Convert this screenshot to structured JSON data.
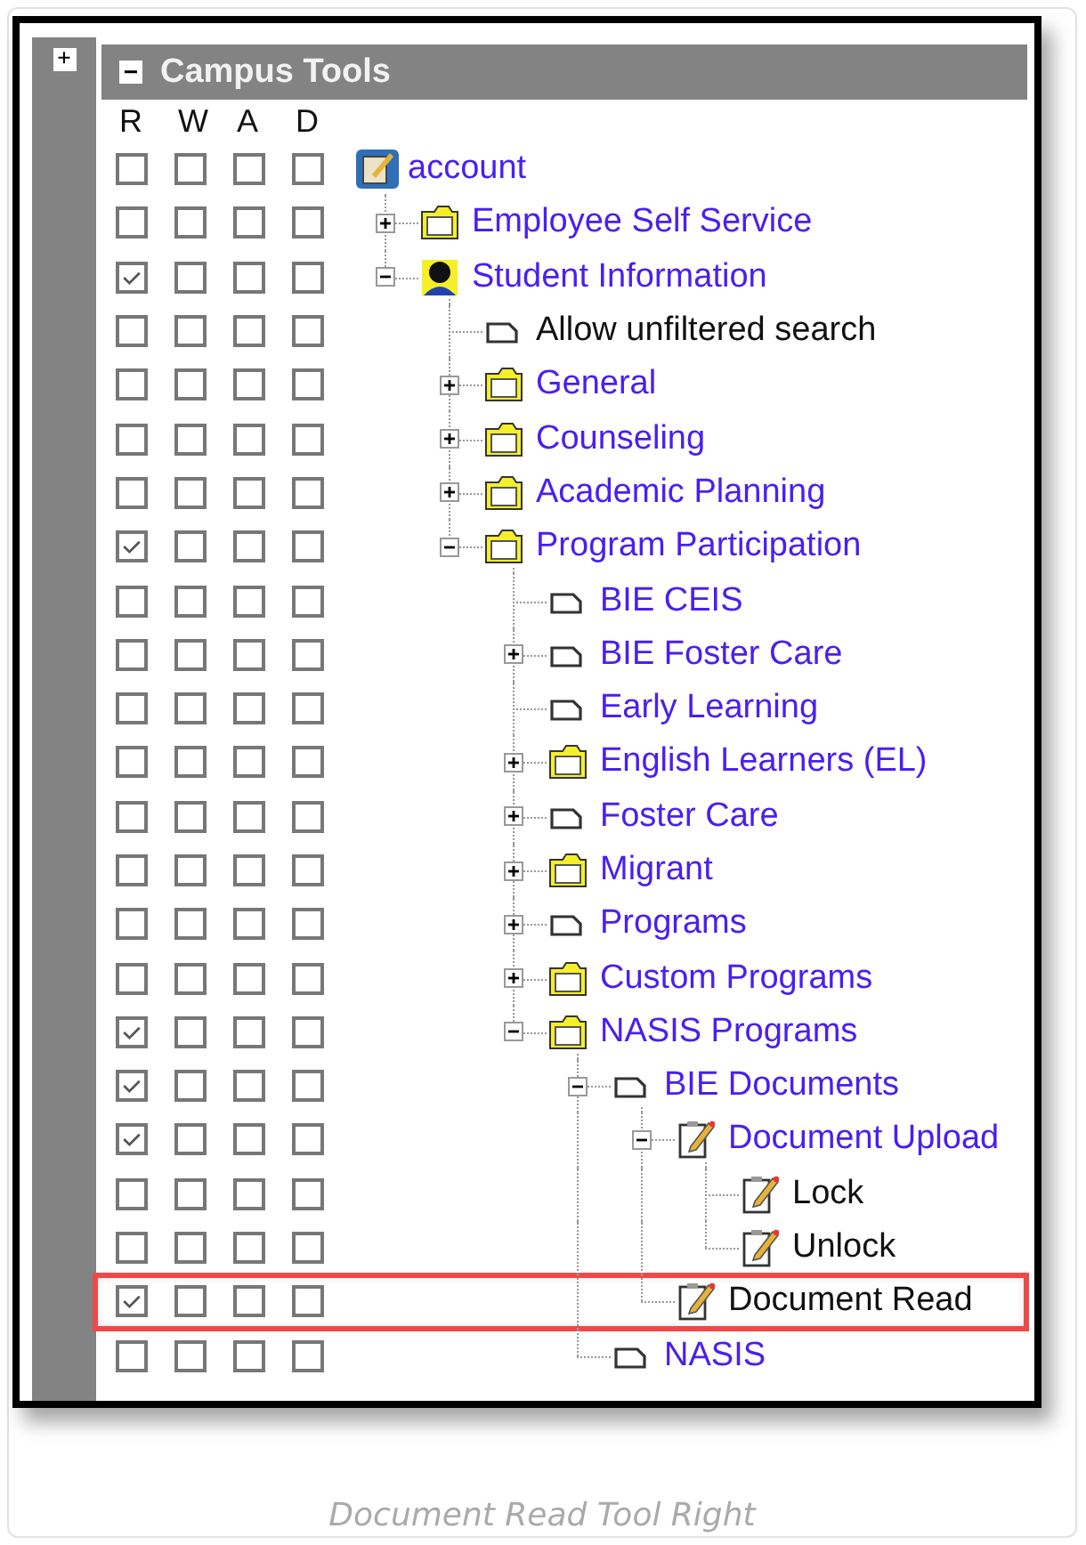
{
  "header": {
    "expand_icon": "+",
    "collapse_icon": "−",
    "title": "Campus Tools"
  },
  "columns": [
    "R",
    "W",
    "A",
    "D"
  ],
  "tree": [
    {
      "label": "account",
      "kind": "account",
      "expandable": false,
      "link": true,
      "highlighted": false,
      "rights": [
        false,
        false,
        false,
        false
      ],
      "children": [
        {
          "label": "Employee Self Service",
          "kind": "folder",
          "expandable": true,
          "expanded": false,
          "link": true,
          "highlighted": false,
          "rights": [
            false,
            false,
            false,
            false
          ]
        },
        {
          "label": "Student Information",
          "kind": "person",
          "expandable": true,
          "expanded": true,
          "link": true,
          "highlighted": false,
          "rights": [
            true,
            false,
            false,
            false
          ],
          "children": [
            {
              "label": "Allow unfiltered search",
              "kind": "page",
              "expandable": false,
              "link": false,
              "highlighted": false,
              "rights": [
                false,
                false,
                false,
                false
              ]
            },
            {
              "label": "General",
              "kind": "folder",
              "expandable": true,
              "expanded": false,
              "link": true,
              "highlighted": false,
              "rights": [
                false,
                false,
                false,
                false
              ]
            },
            {
              "label": "Counseling",
              "kind": "folder",
              "expandable": true,
              "expanded": false,
              "link": true,
              "highlighted": false,
              "rights": [
                false,
                false,
                false,
                false
              ]
            },
            {
              "label": "Academic Planning",
              "kind": "folder",
              "expandable": true,
              "expanded": false,
              "link": true,
              "highlighted": false,
              "rights": [
                false,
                false,
                false,
                false
              ]
            },
            {
              "label": "Program Participation",
              "kind": "folder",
              "expandable": true,
              "expanded": true,
              "link": true,
              "highlighted": false,
              "rights": [
                true,
                false,
                false,
                false
              ],
              "children": [
                {
                  "label": "BIE CEIS",
                  "kind": "page",
                  "expandable": false,
                  "link": true,
                  "highlighted": false,
                  "rights": [
                    false,
                    false,
                    false,
                    false
                  ]
                },
                {
                  "label": "BIE Foster Care",
                  "kind": "page",
                  "expandable": true,
                  "expanded": false,
                  "link": true,
                  "highlighted": false,
                  "rights": [
                    false,
                    false,
                    false,
                    false
                  ]
                },
                {
                  "label": "Early Learning",
                  "kind": "page",
                  "expandable": false,
                  "link": true,
                  "highlighted": false,
                  "rights": [
                    false,
                    false,
                    false,
                    false
                  ]
                },
                {
                  "label": "English Learners (EL)",
                  "kind": "folder",
                  "expandable": true,
                  "expanded": false,
                  "link": true,
                  "highlighted": false,
                  "rights": [
                    false,
                    false,
                    false,
                    false
                  ]
                },
                {
                  "label": "Foster Care",
                  "kind": "page",
                  "expandable": true,
                  "expanded": false,
                  "link": true,
                  "highlighted": false,
                  "rights": [
                    false,
                    false,
                    false,
                    false
                  ]
                },
                {
                  "label": "Migrant",
                  "kind": "folder",
                  "expandable": true,
                  "expanded": false,
                  "link": true,
                  "highlighted": false,
                  "rights": [
                    false,
                    false,
                    false,
                    false
                  ]
                },
                {
                  "label": "Programs",
                  "kind": "page",
                  "expandable": true,
                  "expanded": false,
                  "link": true,
                  "highlighted": false,
                  "rights": [
                    false,
                    false,
                    false,
                    false
                  ]
                },
                {
                  "label": "Custom Programs",
                  "kind": "folder",
                  "expandable": true,
                  "expanded": false,
                  "link": true,
                  "highlighted": false,
                  "rights": [
                    false,
                    false,
                    false,
                    false
                  ]
                },
                {
                  "label": "NASIS Programs",
                  "kind": "folder",
                  "expandable": true,
                  "expanded": true,
                  "link": true,
                  "highlighted": false,
                  "rights": [
                    true,
                    false,
                    false,
                    false
                  ],
                  "children": [
                    {
                      "label": "BIE Documents",
                      "kind": "page",
                      "expandable": true,
                      "expanded": true,
                      "link": true,
                      "highlighted": false,
                      "rights": [
                        true,
                        false,
                        false,
                        false
                      ],
                      "children": [
                        {
                          "label": "Document Upload",
                          "kind": "note",
                          "expandable": true,
                          "expanded": true,
                          "link": true,
                          "highlighted": false,
                          "rights": [
                            true,
                            false,
                            false,
                            false
                          ],
                          "children": [
                            {
                              "label": "Lock",
                              "kind": "note",
                              "expandable": false,
                              "link": false,
                              "highlighted": false,
                              "rights": [
                                false,
                                false,
                                false,
                                false
                              ]
                            },
                            {
                              "label": "Unlock",
                              "kind": "note",
                              "expandable": false,
                              "link": false,
                              "highlighted": false,
                              "rights": [
                                false,
                                false,
                                false,
                                false
                              ]
                            }
                          ]
                        },
                        {
                          "label": "Document Read",
                          "kind": "note",
                          "expandable": false,
                          "link": false,
                          "highlighted": true,
                          "rights": [
                            true,
                            false,
                            false,
                            false
                          ]
                        }
                      ]
                    },
                    {
                      "label": "NASIS",
                      "kind": "page",
                      "expandable": false,
                      "link": true,
                      "highlighted": false,
                      "rights": [
                        false,
                        false,
                        false,
                        false
                      ]
                    }
                  ]
                }
              ]
            }
          ]
        }
      ]
    }
  ],
  "caption": "Document Read Tool Right"
}
